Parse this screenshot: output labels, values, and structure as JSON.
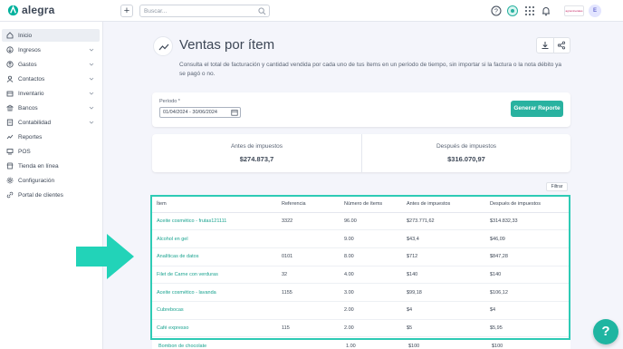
{
  "app": {
    "name": "alegra",
    "brand_chip": "agrominerales"
  },
  "topbar": {
    "add_label": "+",
    "search_placeholder": "Buscar...",
    "avatar_initial": "E"
  },
  "sidebar": {
    "items": [
      {
        "label": "Inicio",
        "icon": "home-icon",
        "expandable": false,
        "active": true
      },
      {
        "label": "Ingresos",
        "icon": "income-icon",
        "expandable": true
      },
      {
        "label": "Gastos",
        "icon": "expenses-icon",
        "expandable": true
      },
      {
        "label": "Contactos",
        "icon": "contacts-icon",
        "expandable": true
      },
      {
        "label": "Inventario",
        "icon": "inventory-icon",
        "expandable": true
      },
      {
        "label": "Bancos",
        "icon": "bank-icon",
        "expandable": true
      },
      {
        "label": "Contabilidad",
        "icon": "accounting-icon",
        "expandable": true
      },
      {
        "label": "Reportes",
        "icon": "reports-icon",
        "expandable": false
      },
      {
        "label": "POS",
        "icon": "pos-icon",
        "expandable": false
      },
      {
        "label": "Tienda en línea",
        "icon": "store-icon",
        "expandable": false
      },
      {
        "label": "Configuración",
        "icon": "settings-icon",
        "expandable": false
      },
      {
        "label": "Portal de clientes",
        "icon": "portal-icon",
        "expandable": false
      }
    ]
  },
  "page": {
    "title": "Ventas por ítem",
    "description": "Consulta el total de facturación y cantidad vendida por cada uno de tus ítems en un período de tiempo, sin importar si la factura o la nota débito ya se pagó o no."
  },
  "filter": {
    "period_label": "Período *",
    "period_value": "01/04/2024 - 30/06/2024",
    "generate_label": "Generar Reporte"
  },
  "totals": {
    "before_label": "Antes de impuestos",
    "before_value": "$274.873,7",
    "after_label": "Después de impuestos",
    "after_value": "$316.070,97"
  },
  "table": {
    "filter_label": "Filtrar",
    "columns": [
      "Ítem",
      "Referencia",
      "Número de ítems",
      "Antes de impuestos",
      "Después de impuestos"
    ],
    "rows": [
      [
        "Aceite cosmético - frutas121111",
        "3322",
        "96.00",
        "$273.771,62",
        "$314.832,33"
      ],
      [
        "Alcohol en gel",
        "",
        "9.00",
        "$43,4",
        "$46,09"
      ],
      [
        "Analíticas de datos",
        "0101",
        "8.00",
        "$712",
        "$847,28"
      ],
      [
        "Filet de Carne con verduras",
        "32",
        "4.00",
        "$140",
        "$140"
      ],
      [
        "Aceite cosmético - lavanda",
        "1155",
        "3.00",
        "$99,18",
        "$106,12"
      ],
      [
        "Cubrebocas",
        "",
        "2.00",
        "$4",
        "$4"
      ],
      [
        "Café expresso",
        "115",
        "2.00",
        "$5",
        "$5,95"
      ]
    ],
    "partial_row": [
      "Bombon de chocolate",
      "",
      "1.00",
      "$100",
      "$100"
    ]
  },
  "colors": {
    "accent": "#29b2a0",
    "highlight": "#2ecbb5",
    "link": "#1aa390"
  },
  "help": {
    "label": "?"
  }
}
